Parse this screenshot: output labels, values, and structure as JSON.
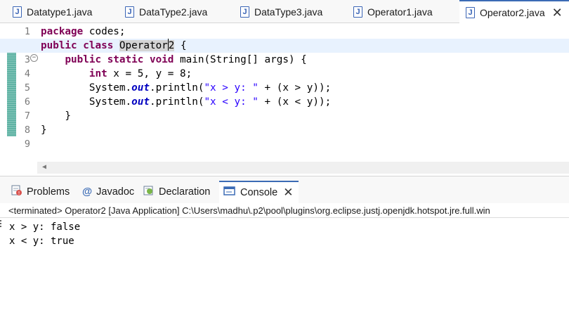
{
  "editor_tabs": [
    {
      "label": "Datatype1.java",
      "active": false
    },
    {
      "label": "DataType2.java",
      "active": false
    },
    {
      "label": "DataType3.java",
      "active": false
    },
    {
      "label": "Operator1.java",
      "active": false
    },
    {
      "label": "Operator2.java",
      "active": true
    }
  ],
  "line_numbers": [
    "1",
    "2",
    "3",
    "4",
    "5",
    "6",
    "7",
    "8",
    "9"
  ],
  "code": {
    "l1_kw": "package",
    "l1_rest": " codes;",
    "l2_kw1": "public",
    "l2_kw2": "class",
    "l2_name_a": "Operator",
    "l2_name_b": "2",
    "l2_rest": " {",
    "l3_indent": "    ",
    "l3_kw1": "public",
    "l3_kw2": "static",
    "l3_kw3": "void",
    "l3_rest": " main(String[] args) {",
    "l4_indent": "        ",
    "l4_kw": "int",
    "l4_rest": " x = 5, y = 8;",
    "l5_indent": "        ",
    "l5_a": "System.",
    "l5_fld": "out",
    "l5_b": ".println(",
    "l5_str": "\"x > y: \"",
    "l5_c": " + (x > y));",
    "l6_indent": "        ",
    "l6_a": "System.",
    "l6_fld": "out",
    "l6_b": ".println(",
    "l6_str": "\"x < y: \"",
    "l6_c": " + (x < y));",
    "l7": "    }",
    "l8": "}",
    "l9": ""
  },
  "view_tabs": [
    {
      "label": "Problems",
      "icon": "problems-icon",
      "active": false
    },
    {
      "label": "Javadoc",
      "icon": "at-icon",
      "active": false
    },
    {
      "label": "Declaration",
      "icon": "declaration-icon",
      "active": false
    },
    {
      "label": "Console",
      "icon": "console-icon",
      "active": true
    }
  ],
  "console": {
    "status": "<terminated> Operator2 [Java Application] C:\\Users\\madhu\\.p2\\pool\\plugins\\org.eclipse.justj.openjdk.hotspot.jre.full.win",
    "output": [
      "x > y: false",
      "x < y: true"
    ]
  },
  "colors": {
    "keyword": "#7f0055",
    "string": "#2a00ff",
    "field": "#0000c0",
    "accent": "#3b6bb5"
  }
}
